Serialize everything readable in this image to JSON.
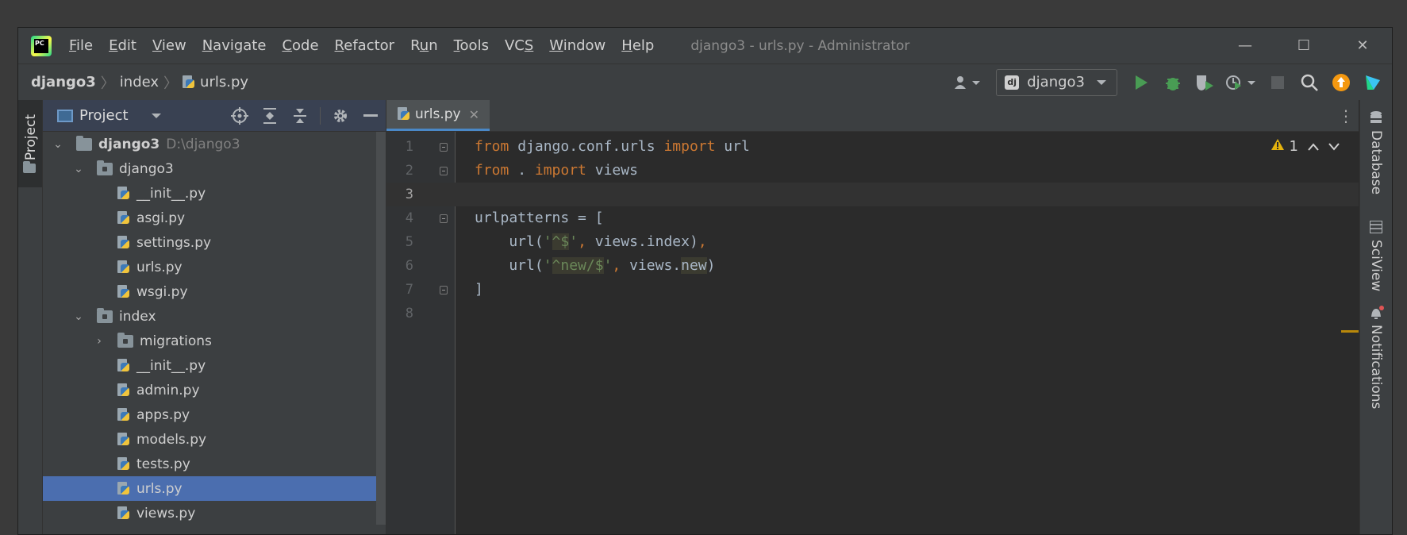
{
  "window": {
    "title": "django3 - urls.py - Administrator",
    "controls": {
      "minimize": "—",
      "maximize": "☐",
      "close": "✕"
    }
  },
  "menu": [
    {
      "pre": "",
      "u": "F",
      "post": "ile"
    },
    {
      "pre": "",
      "u": "E",
      "post": "dit"
    },
    {
      "pre": "",
      "u": "V",
      "post": "iew"
    },
    {
      "pre": "",
      "u": "N",
      "post": "avigate"
    },
    {
      "pre": "",
      "u": "C",
      "post": "ode"
    },
    {
      "pre": "",
      "u": "R",
      "post": "efactor"
    },
    {
      "pre": "R",
      "u": "u",
      "post": "n"
    },
    {
      "pre": "",
      "u": "T",
      "post": "ools"
    },
    {
      "pre": "VC",
      "u": "S",
      "post": ""
    },
    {
      "pre": "",
      "u": "W",
      "post": "indow"
    },
    {
      "pre": "",
      "u": "H",
      "post": "elp"
    }
  ],
  "breadcrumb": {
    "project": "django3",
    "folder": "index",
    "file": "urls.py"
  },
  "toolbar": {
    "run_config": "django3",
    "dj_badge": "dj"
  },
  "left_stripe": {
    "project_tab": "Project"
  },
  "project_panel": {
    "title": "Project",
    "tree": [
      {
        "label": "django3",
        "suffix": "D:\\django3",
        "kind": "root",
        "depth": 0,
        "chevron": "⌄",
        "selected": false
      },
      {
        "label": "django3",
        "suffix": "",
        "kind": "folder",
        "depth": 1,
        "chevron": "⌄",
        "selected": false
      },
      {
        "label": "__init__.py",
        "suffix": "",
        "kind": "py",
        "depth": 2,
        "chevron": "",
        "selected": false
      },
      {
        "label": "asgi.py",
        "suffix": "",
        "kind": "py",
        "depth": 2,
        "chevron": "",
        "selected": false
      },
      {
        "label": "settings.py",
        "suffix": "",
        "kind": "py",
        "depth": 2,
        "chevron": "",
        "selected": false
      },
      {
        "label": "urls.py",
        "suffix": "",
        "kind": "py",
        "depth": 2,
        "chevron": "",
        "selected": false
      },
      {
        "label": "wsgi.py",
        "suffix": "",
        "kind": "py",
        "depth": 2,
        "chevron": "",
        "selected": false
      },
      {
        "label": "index",
        "suffix": "",
        "kind": "folder",
        "depth": 1,
        "chevron": "⌄",
        "selected": false
      },
      {
        "label": "migrations",
        "suffix": "",
        "kind": "folder",
        "depth": 2,
        "chevron": "›",
        "selected": false
      },
      {
        "label": "__init__.py",
        "suffix": "",
        "kind": "py",
        "depth": 2,
        "chevron": "",
        "selected": false
      },
      {
        "label": "admin.py",
        "suffix": "",
        "kind": "py",
        "depth": 2,
        "chevron": "",
        "selected": false
      },
      {
        "label": "apps.py",
        "suffix": "",
        "kind": "py",
        "depth": 2,
        "chevron": "",
        "selected": false
      },
      {
        "label": "models.py",
        "suffix": "",
        "kind": "py",
        "depth": 2,
        "chevron": "",
        "selected": false
      },
      {
        "label": "tests.py",
        "suffix": "",
        "kind": "py",
        "depth": 2,
        "chevron": "",
        "selected": false
      },
      {
        "label": "urls.py",
        "suffix": "",
        "kind": "py",
        "depth": 2,
        "chevron": "",
        "selected": true
      },
      {
        "label": "views.py",
        "suffix": "",
        "kind": "py",
        "depth": 2,
        "chevron": "",
        "selected": false
      }
    ]
  },
  "editor": {
    "tab": {
      "label": "urls.py",
      "close": "✕"
    },
    "inspection": {
      "warning_count": "1"
    },
    "current_line": 3,
    "lines": [
      {
        "n": "1",
        "fold": true,
        "tokens": [
          [
            "kw",
            "from"
          ],
          [
            "plain",
            " django.conf.urls "
          ],
          [
            "kw",
            "import"
          ],
          [
            "plain",
            " url"
          ]
        ]
      },
      {
        "n": "2",
        "fold": true,
        "tokens": [
          [
            "kw",
            "from"
          ],
          [
            "plain",
            " . "
          ],
          [
            "kw",
            "import"
          ],
          [
            "plain",
            " views"
          ]
        ]
      },
      {
        "n": "3",
        "fold": false,
        "tokens": []
      },
      {
        "n": "4",
        "fold": true,
        "tokens": [
          [
            "plain",
            "urlpatterns = ["
          ]
        ]
      },
      {
        "n": "5",
        "fold": false,
        "tokens": [
          [
            "plain",
            "    url("
          ],
          [
            "str",
            "'"
          ],
          [
            "str hl",
            "^$"
          ],
          [
            "str",
            "'"
          ],
          [
            "kw",
            ","
          ],
          [
            "plain",
            " views.index)"
          ],
          [
            "kw",
            ","
          ]
        ]
      },
      {
        "n": "6",
        "fold": false,
        "tokens": [
          [
            "plain",
            "    url("
          ],
          [
            "str",
            "'"
          ],
          [
            "str hl",
            "^new/$"
          ],
          [
            "str",
            "'"
          ],
          [
            "kw",
            ","
          ],
          [
            "plain",
            " views."
          ],
          [
            "plain hl",
            "new"
          ],
          [
            "plain",
            ")"
          ]
        ]
      },
      {
        "n": "7",
        "fold": true,
        "tokens": [
          [
            "plain",
            "]"
          ]
        ]
      },
      {
        "n": "8",
        "fold": false,
        "tokens": []
      }
    ]
  },
  "right_stripe": {
    "database": "Database",
    "sciview": "SciView",
    "notifications": "Notifications"
  },
  "colors": {
    "accent": "#4a88c7",
    "selection": "#4b6eaf",
    "keyword": "#cc7832",
    "string": "#6a8759",
    "warning": "#e5b30d"
  }
}
